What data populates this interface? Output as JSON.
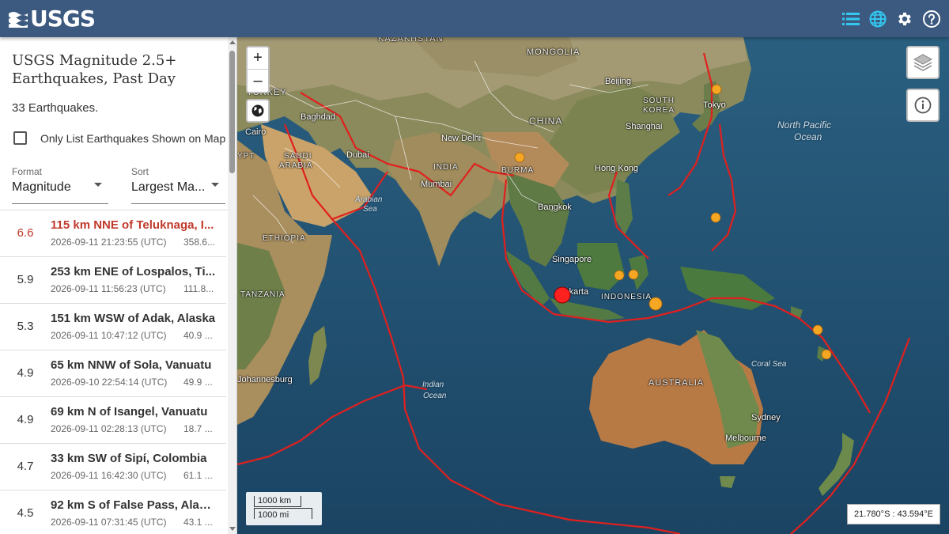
{
  "header": {
    "logo_text": "USGS",
    "icons": [
      "list-icon",
      "globe-icon",
      "gear-icon",
      "help-icon"
    ],
    "background": "#3c5a80",
    "active_icon_color": "#32c8f0"
  },
  "sidebar": {
    "title": "USGS Magnitude 2.5+ Earthquakes, Past Day",
    "count_text": "33 Earthquakes.",
    "only_list_label": "Only List Earthquakes Shown on Map",
    "format": {
      "label": "Format",
      "value": "Magnitude"
    },
    "sort": {
      "label": "Sort",
      "value": "Largest Ma..."
    },
    "rows": [
      {
        "mag": "6.6",
        "place": "115 km NNE of Teluknaga, I...",
        "time": "2026-09-11 21:23:55 (UTC)",
        "depth": "358.6...",
        "selected": true
      },
      {
        "mag": "5.9",
        "place": "253 km ENE of Lospalos, Ti...",
        "time": "2026-09-11 11:56:23 (UTC)",
        "depth": "111.8...",
        "selected": false
      },
      {
        "mag": "5.3",
        "place": "151 km WSW of Adak, Alaska",
        "time": "2026-09-11 10:47:12 (UTC)",
        "depth": "40.9 ...",
        "selected": false
      },
      {
        "mag": "4.9",
        "place": "65 km NNW of Sola, Vanuatu",
        "time": "2026-09-10 22:54:14 (UTC)",
        "depth": "49.9 ...",
        "selected": false
      },
      {
        "mag": "4.9",
        "place": "69 km N of Isangel, Vanuatu",
        "time": "2026-09-11 02:28:13 (UTC)",
        "depth": "18.7 ...",
        "selected": false
      },
      {
        "mag": "4.7",
        "place": "33 km SW of Sipí, Colombia",
        "time": "2026-09-11 16:42:30 (UTC)",
        "depth": "61.1 ...",
        "selected": false
      },
      {
        "mag": "4.5",
        "place": "92 km S of False Pass, Alaska",
        "time": "2026-09-11 07:31:45 (UTC)",
        "depth": "43.1 ...",
        "selected": false
      }
    ]
  },
  "map": {
    "zoom_in": "+",
    "zoom_out": "–",
    "labels": {
      "kazakhstan": "KAZAKHSTAN",
      "mongolia": "MONGOLIA",
      "turkey": "TURKEY",
      "beijing": "Beijing",
      "south_korea_1": "SOUTH",
      "south_korea_2": "KOREA",
      "tokyo": "Tokyo",
      "baghdad": "Baghdad",
      "china": "CHINA",
      "shanghai": "Shanghai",
      "north_pacific_1": "North Pacific",
      "north_pacific_2": "Ocean",
      "cairo": "Cairo",
      "new_delhi": "New Delhi",
      "egypt": "YPT",
      "saudi_1": "SAUDI",
      "saudi_2": "ARABIA",
      "dubai": "Dubai",
      "burma": "BURMA",
      "india": "INDIA",
      "hong_kong": "Hong Kong",
      "mumbai": "Mumbai",
      "arabian_1": "Arabian",
      "arabian_2": "Sea",
      "bangkok": "Bangkok",
      "ethiopia": "ETHIOPIA",
      "singapore": "Singapore",
      "jakarta": "Jakarta",
      "indonesia": "INDONESIA",
      "tanzania": "TANZANIA",
      "coral_sea": "Coral Sea",
      "indian_1": "Indian",
      "indian_2": "Ocean",
      "johannesburg": "Johannesburg",
      "australia": "AUSTRALIA",
      "sydney": "Sydney",
      "melbourne": "Melbourne"
    },
    "scale_km": "1000 km",
    "scale_mi": "1000 mi",
    "coords": "21.780°S : 43.594°E",
    "quake_color": "#f5a623",
    "selected_quake_color": "#ff2020",
    "plate_boundary_color": "#e0201e"
  }
}
